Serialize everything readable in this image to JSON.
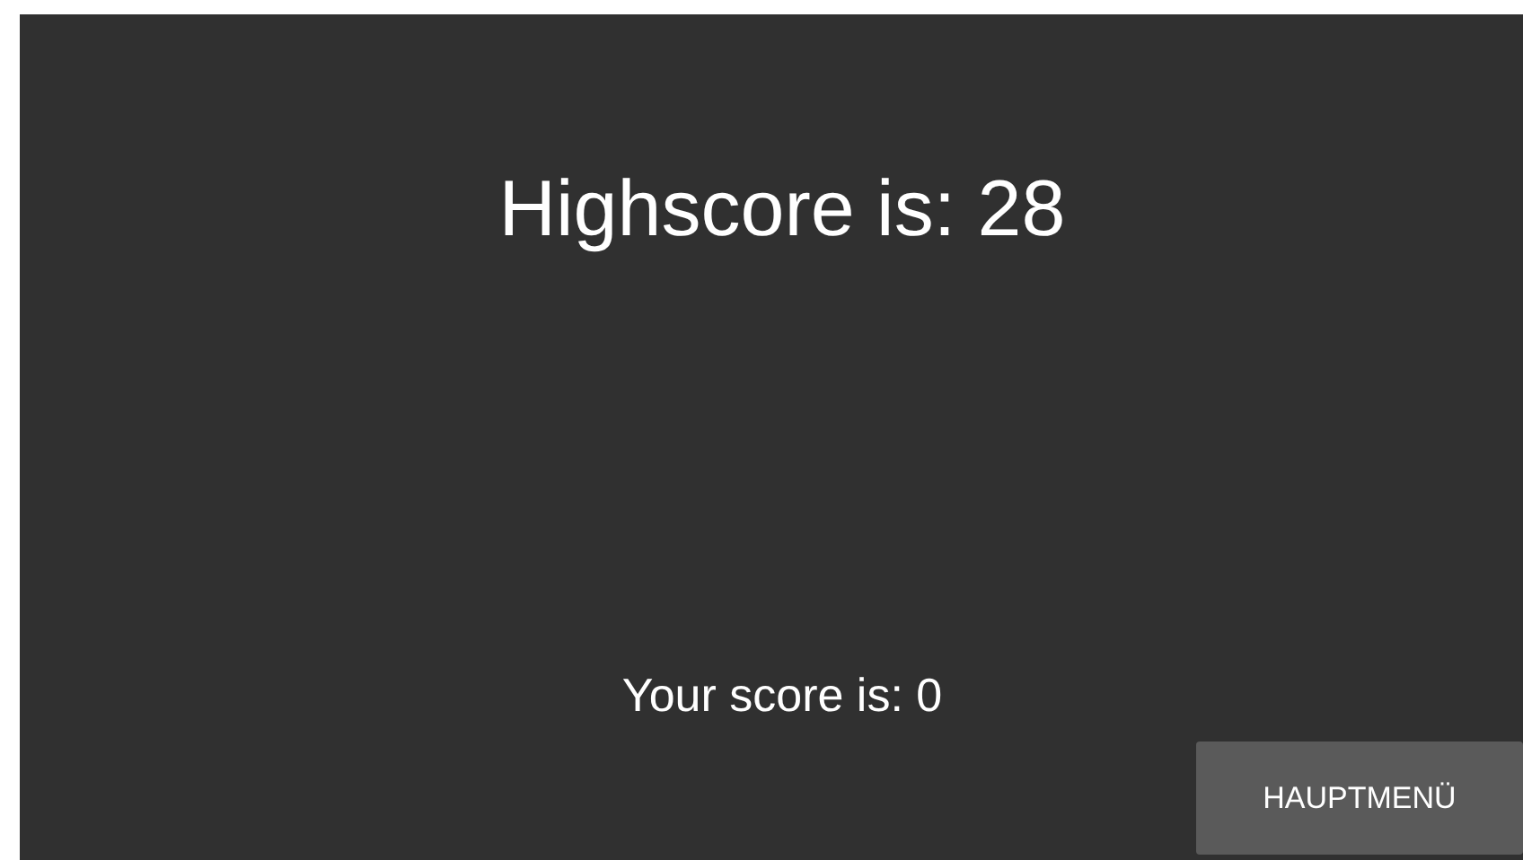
{
  "highscore": "Highscore is: 28",
  "score": "Your score is: 0",
  "buttons": [
    {
      "label": "HAUPTMENÜ"
    }
  ]
}
